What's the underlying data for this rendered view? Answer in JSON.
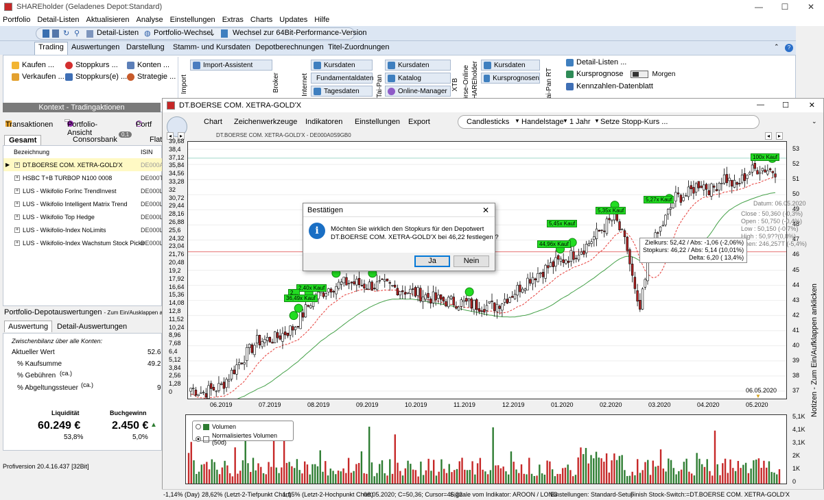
{
  "app": {
    "title": "SHAREholder (Geladenes Depot:Standard)",
    "win_min": "—",
    "win_max": "☐",
    "win_close": "✕"
  },
  "menu": [
    "Portfolio",
    "Detail-Listen",
    "Aktualisieren",
    "Analyse",
    "Einstellungen",
    "Extras",
    "Charts",
    "Updates",
    "Hilfe"
  ],
  "quickbar": {
    "detail": "Detail-Listen",
    "portfolio": "Portfolio-Wechsel",
    "switch64": "Wechsel zur 64Bit-Performance-Version"
  },
  "ribbon_tabs": [
    "Trading",
    "Auswertungen",
    "Darstellung",
    "Stamm- und Kursdaten",
    "Depotberechnungen",
    "Titel-Zuordnungen"
  ],
  "ribbon": {
    "kaufen": "Kaufen ...",
    "verkaufen": "Verkaufen ...",
    "stoppkurs": "Stoppkurs ...",
    "stoppkurse": "Stoppkurs(e) ...",
    "konten": "Konten ...",
    "strategie": "Strategie ...",
    "context": "Kontext - Tradingaktionen",
    "import_label": "Import",
    "import_assistent": "Import-Assistent",
    "broker": "Broker",
    "internet": "Internet",
    "kursdaten": "Kursdaten",
    "fundamental": "Fundamentaldaten",
    "tagesdaten": "Tagesdaten",
    "taipan": "Tai-Pan",
    "katalog": "Katalog",
    "online_manager": "Online-Manager",
    "xtb": "XTB",
    "boerse_online": "Börse-Online",
    "shareholder": "SHAREholder",
    "kursprognosen": "Kursprognosen",
    "taipan_rt": "Tai-Pan RT",
    "detail_listen": "Detail-Listen ...",
    "kursprognose": "Kursprognose",
    "morgen": "Morgen",
    "kennzahlen": "Kennzahlen-Datenblatt"
  },
  "left": {
    "tabs": [
      "Transaktionen",
      "Portfolio-Ansicht",
      "Portf"
    ],
    "subtabs": [
      "Gesamt",
      "Consorsbank",
      "Flat"
    ],
    "badge": "0,1",
    "col_bez": "Bezeichnung",
    "col_isin": "ISIN",
    "rows": [
      {
        "name": "DT.BOERSE COM. XETRA-GOLD'X",
        "isin": "DE000A"
      },
      {
        "name": "HSBC T+B TURBOP N100 0008",
        "isin": "DE000T"
      },
      {
        "name": "LUS - Wikifolio ForInc TrendInvest",
        "isin": "DE000L"
      },
      {
        "name": "LUS - Wikifolio Intelligent Matrix Trend",
        "isin": "DE000L"
      },
      {
        "name": "LUS - Wikifolio Top Hedge",
        "isin": "DE000L"
      },
      {
        "name": "LUS - Wikifolio-Index NoLimits",
        "isin": "DE000L"
      },
      {
        "name": "LUS - Wikifolio-Index Wachstum Stock Pickin",
        "isin": "DE000L"
      }
    ],
    "depot_title": "Portfolio-Depotauswertungen",
    "depot_hint": "- Zum Ein/Ausklappen anklick",
    "tab_auswertung": "Auswertung",
    "tab_detail": "Detail-Auswertungen",
    "zwischen": "Zwischenbilanz über alle Konten:",
    "aktueller_wert": "Aktueller Wert",
    "aktueller_wert_v": "52.6",
    "kaufsumme": "% Kaufsumme",
    "kaufsumme_v": "49.2",
    "gebuehren": "% Gebühren",
    "gebuehren_ca": "(ca.)",
    "abgeltung": "% Abgeltungssteuer",
    "abgeltung_ca": "(ca.)",
    "abgeltung_v": "9",
    "liquiditaet": "Liquidität",
    "buchgewinn": "Buchgewinn",
    "liq_v": "60.249 €",
    "buch_v": "2.450 €",
    "liq_pct": "53,8%",
    "buch_pct": "5,0%",
    "version": "Profiversion 20.4.16.437 [32Bit]"
  },
  "chartwin": {
    "title": "DT.BOERSE COM. XETRA-GOLD'X",
    "menu": [
      "Chart",
      "Zeichenwerkzeuge",
      "Indikatoren",
      "Einstellungen",
      "Export"
    ],
    "pill": [
      "Candlesticks",
      "Handelstage",
      "1 Jahr",
      "Setze Stopp-Kurs ..."
    ],
    "header": "DT.BOERSE COM. XETRA-GOLD'X - DE000A0S9GB0",
    "notes": "Notizen - Zum Ein/Aufklappen anklicken",
    "date_label": "06.05.2020",
    "tags": [
      "100x Kauf",
      "5,27x Kauf",
      "5,35x Kauf",
      "5,45x Kauf",
      "44,96x Kauf",
      "2,40x Kauf",
      "2,..",
      "36,49x Kauf"
    ],
    "info": [
      "Datum: 06.05.2020",
      "Close : 50,360 (-0,3%)",
      "Open : 50,750 (-0,4%)",
      "Low : 50,150 (-0,7%)",
      "High : 50,9??(0,8%)",
      "Volumen: 246,257T (-5,4%)"
    ],
    "stop_tip": [
      "Zielkurs: 52,42 / Abs: -1,06 (-2,06%)",
      "Stopkurs: 46,22 / Abs: 5,14 (10,01%)",
      "Delta: 6,20 ( 13,4%)"
    ],
    "legend": [
      "Volumen",
      "Normalisiertes Volumen (50d)"
    ]
  },
  "dialog": {
    "title": "Bestätigen",
    "line1": "Möchten Sie wirklich den Stopkurs für den Depotwert",
    "line2": "DT.BOERSE COM. XETRA-GOLD'X bei 46,22 festlegen ?",
    "yes": "Ja",
    "no": "Nein"
  },
  "status": [
    "-1,14% (Day)",
    "28,62% (Letzt-2-Tiefpunkt Chart)",
    "1,15% (Letzt-2-Hochpunkt Chart)",
    "06.05.2020; C=50,36; Cursor=46,22",
    "Signale vom Indikator: AROON / LONG",
    "Einstellungen: Standard-Setup",
    "Finish Stock-Switch:=DT.BOERSE COM. XETRA-GOLD'X"
  ],
  "colors": {
    "up": "#ffffff",
    "down": "#b22222",
    "green": "#22dd22",
    "ma_red": "#e53935",
    "ma_green": "#43a047",
    "stop": "#e57373",
    "vol_red": "#c62828",
    "vol_green": "#2e7d32"
  },
  "chart_data": {
    "type": "candlestick",
    "title": "DT.BOERSE COM. XETRA-GOLD'X - DE000A0S9GB0",
    "x": [
      "06.2019",
      "07.2019",
      "08.2019",
      "09.2019",
      "10.2019",
      "11.2019",
      "12.2019",
      "01.2020",
      "02.2020",
      "03.2020",
      "04.2020",
      "05.2020"
    ],
    "left_axis": [
      "39,68",
      "38,4",
      "37,12",
      "35,84",
      "34,56",
      "33,28",
      "32",
      "30,72",
      "29,44",
      "28,16",
      "26,88",
      "25,6",
      "24,32",
      "23,04",
      "21,76",
      "20,48",
      "19,2",
      "17,92",
      "16,64",
      "15,36",
      "14,08",
      "12,8",
      "11,52",
      "10,24",
      "8,96",
      "7,68",
      "6,4",
      "5,12",
      "3,84",
      "2,56",
      "1,28",
      "0"
    ],
    "right_axis": [
      "53",
      "52",
      "51",
      "50",
      "49",
      "48",
      "47",
      "46",
      "45",
      "44",
      "43",
      "42",
      "41",
      "40",
      "39",
      "38",
      "37"
    ],
    "ylim": [
      36.5,
      53.5
    ],
    "close_path": [
      [
        0,
        37.2
      ],
      [
        0.02,
        36.9
      ],
      [
        0.05,
        37.3
      ],
      [
        0.08,
        38.9
      ],
      [
        0.11,
        40.3
      ],
      [
        0.14,
        40.5
      ],
      [
        0.17,
        41.2
      ],
      [
        0.2,
        43.0
      ],
      [
        0.23,
        43.9
      ],
      [
        0.26,
        44.2
      ],
      [
        0.29,
        44.0
      ],
      [
        0.32,
        44.0
      ],
      [
        0.35,
        43.7
      ],
      [
        0.38,
        43.4
      ],
      [
        0.41,
        43.0
      ],
      [
        0.44,
        42.9
      ],
      [
        0.47,
        42.7
      ],
      [
        0.5,
        42.6
      ],
      [
        0.53,
        43.4
      ],
      [
        0.56,
        44.5
      ],
      [
        0.59,
        45.2
      ],
      [
        0.62,
        45.8
      ],
      [
        0.65,
        46.5
      ],
      [
        0.68,
        47.8
      ],
      [
        0.7,
        48.5
      ],
      [
        0.72,
        46.5
      ],
      [
        0.74,
        42.0
      ],
      [
        0.76,
        46.5
      ],
      [
        0.78,
        48.1
      ],
      [
        0.8,
        49.8
      ],
      [
        0.82,
        50.0
      ],
      [
        0.84,
        50.8
      ],
      [
        0.86,
        50.3
      ],
      [
        0.88,
        51.2
      ],
      [
        0.9,
        50.5
      ],
      [
        0.92,
        51.5
      ],
      [
        0.94,
        51.8
      ],
      [
        0.96,
        51.6
      ]
    ],
    "stop_level": 46.22,
    "volume_axis": [
      "5,1K",
      "4,1K",
      "3,1K",
      "2K",
      "1K",
      "0"
    ]
  }
}
